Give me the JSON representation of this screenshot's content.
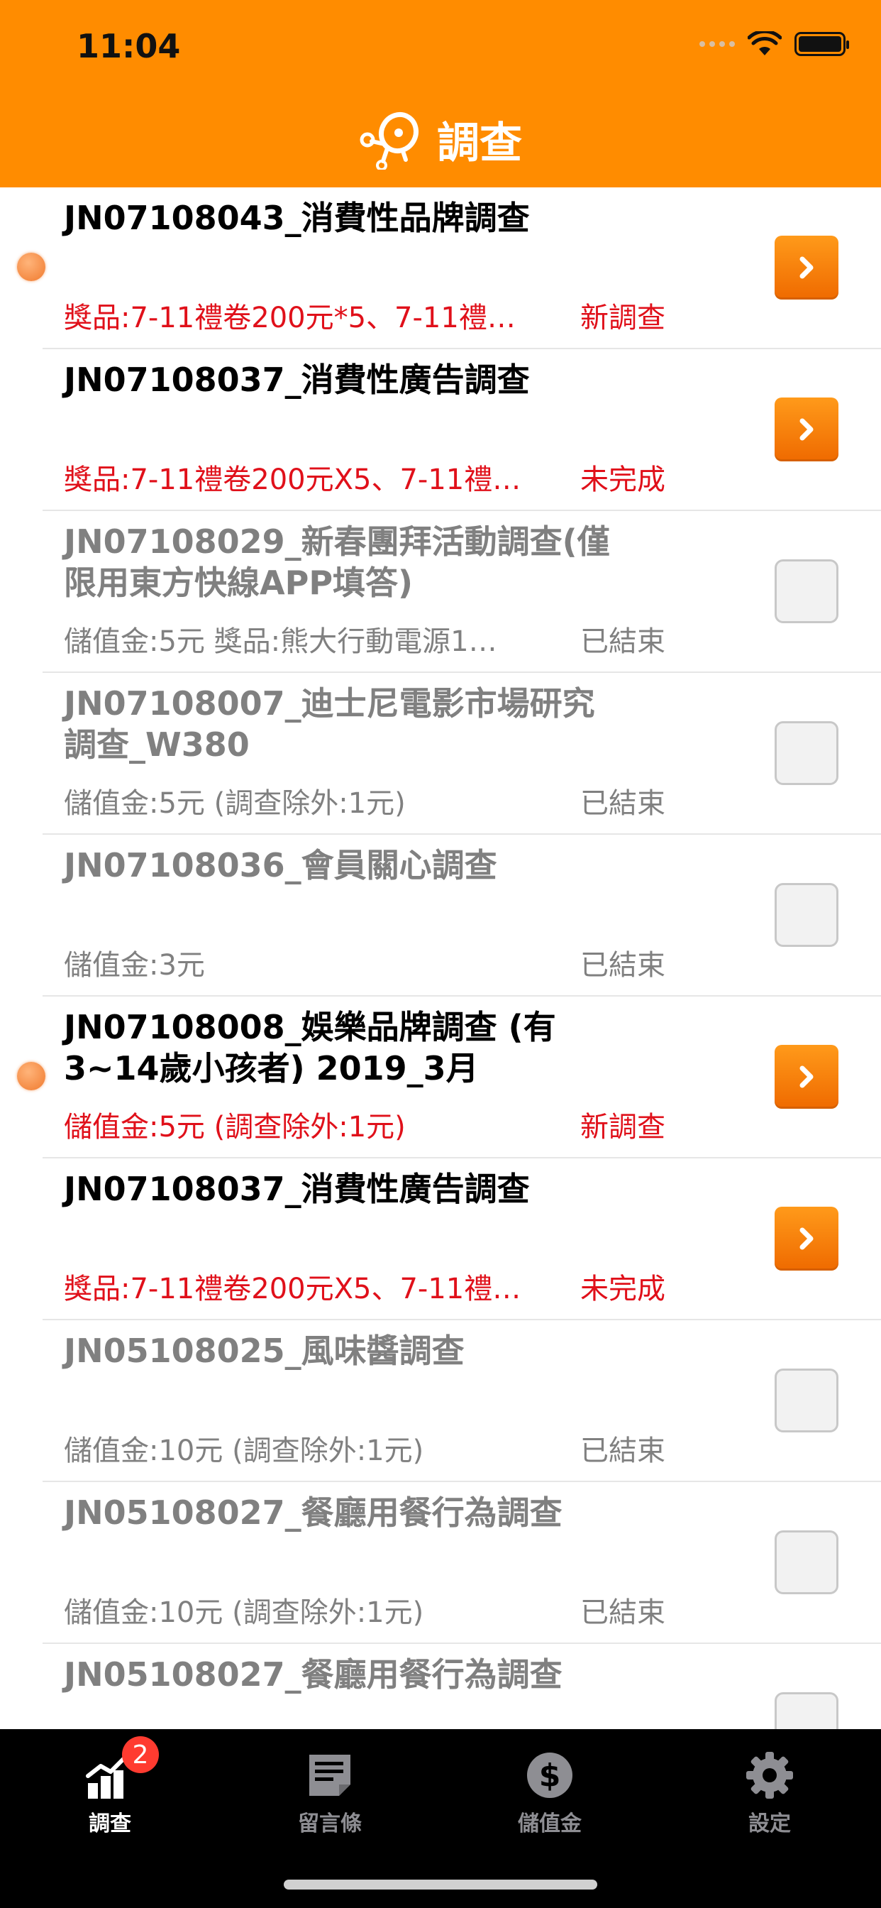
{
  "status_bar": {
    "time": "11:04"
  },
  "header": {
    "title": "調查",
    "logo_icon": "survey-logo-icon"
  },
  "colors": {
    "header_bg": "#ff8c00",
    "highlight_text": "#e0101a",
    "ended_text": "#808080",
    "go_button": "#f57a00",
    "tabbar_bg": "#000000"
  },
  "surveys": [
    {
      "title": "JN07108043_消費性品牌調查",
      "reward": "獎品:7-11禮卷200元*5、7-11禮…",
      "status": "新調查",
      "state": "new"
    },
    {
      "title": "JN07108037_消費性廣告調查",
      "reward": "獎品:7-11禮卷200元X5、7-11禮…",
      "status": "未完成",
      "state": "incomplete"
    },
    {
      "title": "JN07108029_新春團拜活動調查(僅限用東方快線APP填答)",
      "reward": "儲值金:5元 獎品:熊大行動電源1…",
      "status": "已結束",
      "state": "ended"
    },
    {
      "title": "JN07108007_迪士尼電影市場研究調查_W380",
      "reward": "儲值金:5元 (調查除外:1元)",
      "status": "已結束",
      "state": "ended"
    },
    {
      "title": "JN07108036_會員關心調查",
      "reward": "儲值金:3元",
      "status": "已結束",
      "state": "ended"
    },
    {
      "title": "JN07108008_娛樂品牌調查 (有3~14歲小孩者) 2019_3月",
      "reward": "儲值金:5元 (調查除外:1元)",
      "status": "新調查",
      "state": "new"
    },
    {
      "title": "JN07108037_消費性廣告調查",
      "reward": "獎品:7-11禮卷200元X5、7-11禮…",
      "status": "未完成",
      "state": "incomplete"
    },
    {
      "title": "JN05108025_風味醬調查",
      "reward": "儲值金:10元 (調查除外:1元)",
      "status": "已結束",
      "state": "ended"
    },
    {
      "title": "JN05108027_餐廳用餐行為調查",
      "reward": "儲值金:10元 (調查除外:1元)",
      "status": "已結束",
      "state": "ended"
    },
    {
      "title": "JN05108027_餐廳用餐行為調查",
      "reward": "",
      "status": "",
      "state": "ended"
    }
  ],
  "tabbar": {
    "tabs": [
      {
        "label": "調查",
        "icon": "chart-icon",
        "badge": "2",
        "active": true
      },
      {
        "label": "留言條",
        "icon": "note-icon",
        "badge": "",
        "active": false
      },
      {
        "label": "儲值金",
        "icon": "dollar-icon",
        "badge": "",
        "active": false
      },
      {
        "label": "設定",
        "icon": "gear-icon",
        "badge": "",
        "active": false
      }
    ]
  }
}
